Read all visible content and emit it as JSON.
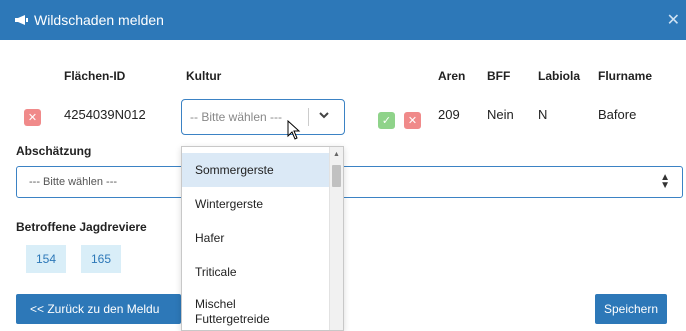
{
  "window": {
    "title": "Wildschaden melden",
    "close_glyph": "✕"
  },
  "table": {
    "headers": {
      "flaechen_id": "Flächen-ID",
      "kultur": "Kultur",
      "aren": "Aren",
      "bff": "BFF",
      "labiola": "Labiola",
      "flurname": "Flurname"
    },
    "row": {
      "flaechen_id": "4254039N012",
      "kultur_placeholder": "-- Bitte wählen ---",
      "aren": "209",
      "bff": "Nein",
      "labiola": "N",
      "flurname": "Bafore"
    }
  },
  "abschaetzung": {
    "label": "Abschätzung",
    "placeholder": "--- Bitte wählen ---"
  },
  "jagdreviere": {
    "label": "Betroffene Jagdreviere",
    "items": [
      "154",
      "165"
    ]
  },
  "buttons": {
    "back": "<< Zurück zu den Meldu",
    "save": "Speichern"
  },
  "kultur_options": [
    {
      "label": "Sommergerste",
      "highlighted": true
    },
    {
      "label": "Wintergerste"
    },
    {
      "label": "Hafer"
    },
    {
      "label": "Triticale"
    },
    {
      "label": "Mischel",
      "label2": "Futtergetreide"
    }
  ],
  "colors": {
    "primary": "#2d78b8",
    "danger": "#f08a8a",
    "success": "#8fd38a",
    "badge_bg": "#d9eef8"
  }
}
